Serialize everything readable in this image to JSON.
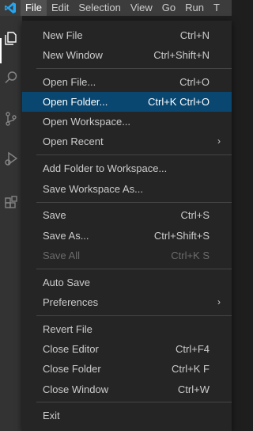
{
  "colors": {
    "titlebar_bg": "#3c3c3c",
    "activitybar_bg": "#333333",
    "menu_bg": "#252526",
    "highlight_bg": "#094771",
    "logo_blue": "#007acc"
  },
  "app": {
    "logo_icon": "vscode-logo-icon"
  },
  "menubar": {
    "items": [
      "File",
      "Edit",
      "Selection",
      "View",
      "Go",
      "Run",
      "T"
    ]
  },
  "activitybar": {
    "icons": [
      "explorer-icon",
      "search-icon",
      "source-control-icon",
      "run-debug-icon",
      "extensions-icon"
    ]
  },
  "file_menu": {
    "new_file": {
      "label": "New File",
      "shortcut": "Ctrl+N"
    },
    "new_window": {
      "label": "New Window",
      "shortcut": "Ctrl+Shift+N"
    },
    "open_file": {
      "label": "Open File...",
      "shortcut": "Ctrl+O"
    },
    "open_folder": {
      "label": "Open Folder...",
      "shortcut": "Ctrl+K Ctrl+O"
    },
    "open_workspace": {
      "label": "Open Workspace..."
    },
    "open_recent": {
      "label": "Open Recent"
    },
    "add_folder": {
      "label": "Add Folder to Workspace..."
    },
    "save_workspace_as": {
      "label": "Save Workspace As..."
    },
    "save": {
      "label": "Save",
      "shortcut": "Ctrl+S"
    },
    "save_as": {
      "label": "Save As...",
      "shortcut": "Ctrl+Shift+S"
    },
    "save_all": {
      "label": "Save All",
      "shortcut": "Ctrl+K S"
    },
    "auto_save": {
      "label": "Auto Save"
    },
    "preferences": {
      "label": "Preferences"
    },
    "revert_file": {
      "label": "Revert File"
    },
    "close_editor": {
      "label": "Close Editor",
      "shortcut": "Ctrl+F4"
    },
    "close_folder": {
      "label": "Close Folder",
      "shortcut": "Ctrl+K F"
    },
    "close_window": {
      "label": "Close Window",
      "shortcut": "Ctrl+W"
    },
    "exit": {
      "label": "Exit"
    },
    "submenu_arrow": "›"
  }
}
